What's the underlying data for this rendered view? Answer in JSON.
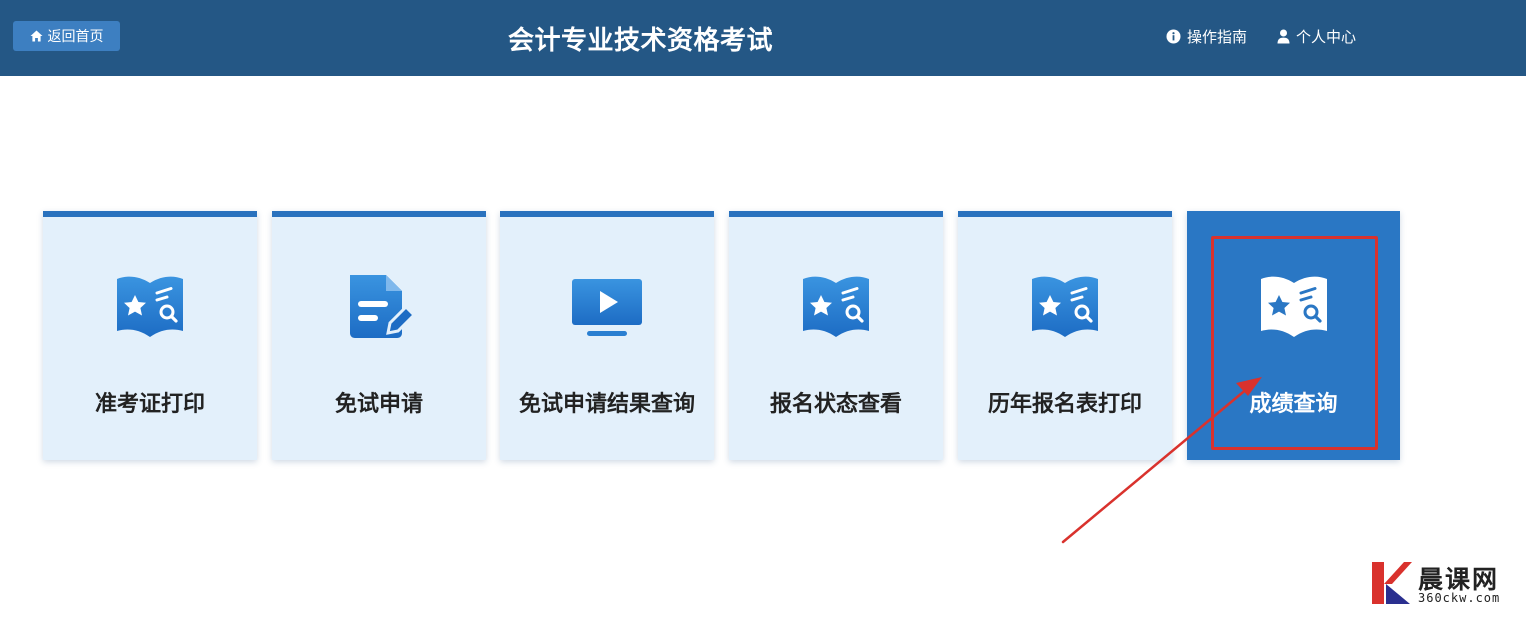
{
  "header": {
    "home_label": "返回首页",
    "title": "会计专业技术资格考试",
    "guide_label": "操作指南",
    "profile_label": "个人中心",
    "background_color": "#245785"
  },
  "cards": [
    {
      "label": "准考证打印",
      "icon": "book-star-search-icon"
    },
    {
      "label": "免试申请",
      "icon": "document-edit-icon"
    },
    {
      "label": "免试申请结果查询",
      "icon": "video-monitor-icon"
    },
    {
      "label": "报名状态查看",
      "icon": "book-star-search-icon"
    },
    {
      "label": "历年报名表打印",
      "icon": "book-star-search-icon"
    },
    {
      "label": "成绩查询",
      "icon": "book-star-search-icon",
      "active": true
    }
  ],
  "colors": {
    "card_bg": "#e3f0fb",
    "card_accent": "#2a72be",
    "active_bg": "#2a77c4",
    "highlight": "#d9322d"
  },
  "watermark": {
    "name": "晨课网",
    "url": "360ckw.com"
  }
}
